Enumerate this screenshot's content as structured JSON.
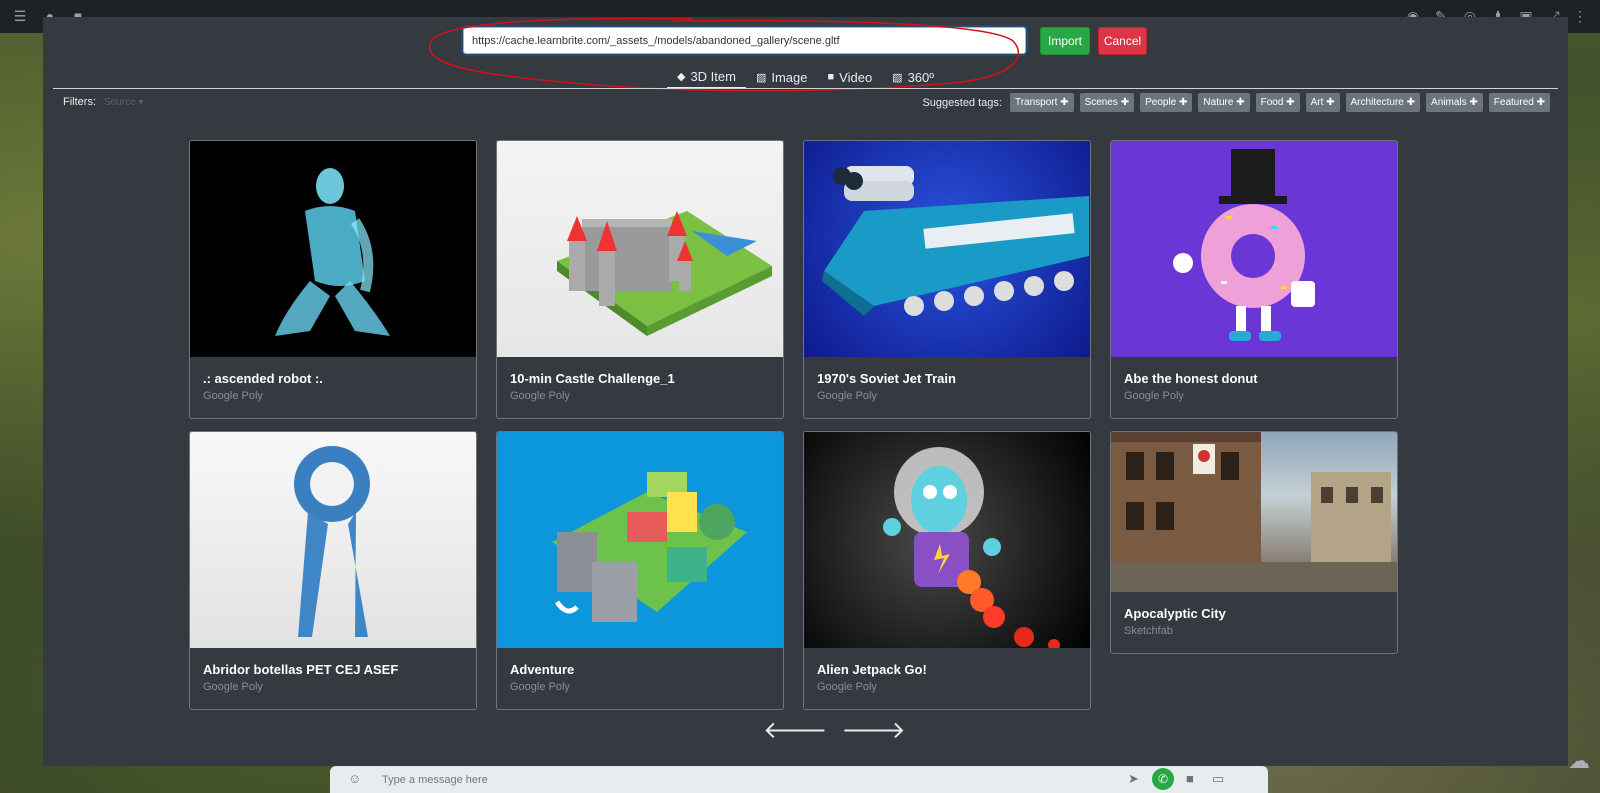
{
  "url_bar": {
    "value": "https://cache.learnbrite.com/_assets_/models/abandoned_gallery/scene.gltf",
    "import_label": "Import",
    "cancel_label": "Cancel"
  },
  "tabs": [
    {
      "label": "3D Item",
      "icon": "cube-icon",
      "active": true
    },
    {
      "label": "Image",
      "icon": "image-icon",
      "active": false
    },
    {
      "label": "Video",
      "icon": "video-icon",
      "active": false
    },
    {
      "label": "360º",
      "icon": "panorama-icon",
      "active": false
    }
  ],
  "filters": {
    "label": "Filters:",
    "source_placeholder": "Source"
  },
  "suggested_tags": {
    "label": "Suggested tags:",
    "items": [
      "Transport",
      "Scenes",
      "People",
      "Nature",
      "Food",
      "Art",
      "Architecture",
      "Animals",
      "Featured"
    ]
  },
  "items": [
    {
      "title": ".: ascended robot :.",
      "source": "Google Poly"
    },
    {
      "title": "10-min Castle Challenge_1",
      "source": "Google Poly"
    },
    {
      "title": "1970's Soviet Jet Train",
      "source": "Google Poly"
    },
    {
      "title": "Abe the honest donut",
      "source": "Google Poly"
    },
    {
      "title": "Abridor botellas PET CEJ ASEF",
      "source": "Google Poly"
    },
    {
      "title": "Adventure",
      "source": "Google Poly"
    },
    {
      "title": "Alien Jetpack Go!",
      "source": "Google Poly"
    },
    {
      "title": "Apocalyptic City",
      "source": "Sketchfab"
    }
  ],
  "chat": {
    "placeholder": "Type a message here"
  },
  "colors": {
    "modal_bg": "#343a40",
    "import": "#28a745",
    "cancel": "#dc3545",
    "tag_bg": "#6c757d",
    "annotation": "#d0121b"
  }
}
